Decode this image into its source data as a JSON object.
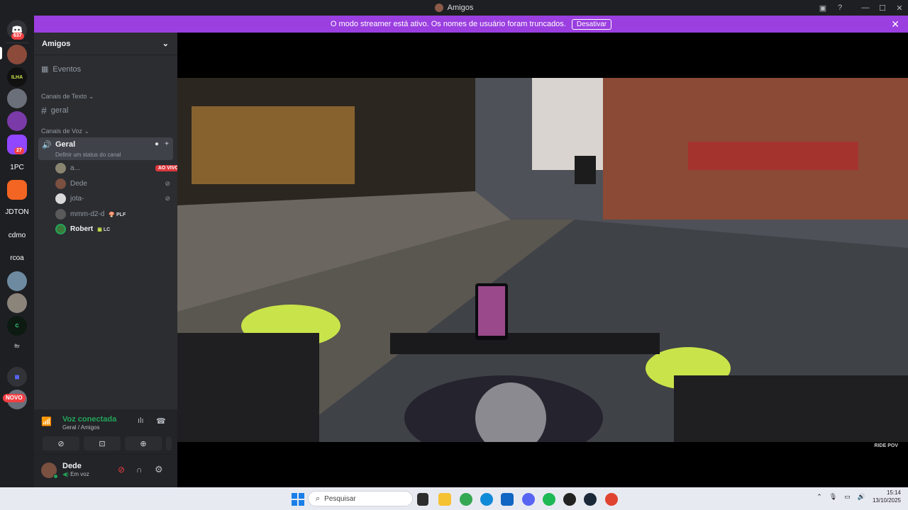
{
  "window": {
    "title": "Amigos"
  },
  "banner": {
    "message": "O modo streamer está ativo. Os nomes de usuário foram truncados.",
    "button_label": "Desativar"
  },
  "rail": {
    "home_badge": "637",
    "twitch_badge": "27",
    "text_servers": [
      "1PC",
      "JDTON",
      "cdmo",
      "rcoa"
    ],
    "new_label": "NOVO"
  },
  "sidebar": {
    "server_name": "Amigos",
    "events_label": "Eventos",
    "text_category": "Canais de Texto",
    "text_channel": "geral",
    "voice_category": "Canais de Voz",
    "voice_channel": "Geral",
    "voice_status_hint": "Definir um status do canal",
    "users": [
      {
        "name": "a...",
        "status": "AO VIVO"
      },
      {
        "name": "Dede"
      },
      {
        "name": "jota-"
      },
      {
        "name": "mmm-d2-d",
        "tag": "PLF"
      },
      {
        "name": "Robert",
        "tag": "LC"
      }
    ]
  },
  "voice_panel": {
    "status": "Voz conectada",
    "location": "Geral / Amigos"
  },
  "user_panel": {
    "name": "Dede",
    "status": "Em voz"
  },
  "video": {
    "watermark": "RIDE POV"
  },
  "taskbar": {
    "search_placeholder": "Pesquisar",
    "time": "15:14",
    "date": "13/10/2025"
  }
}
